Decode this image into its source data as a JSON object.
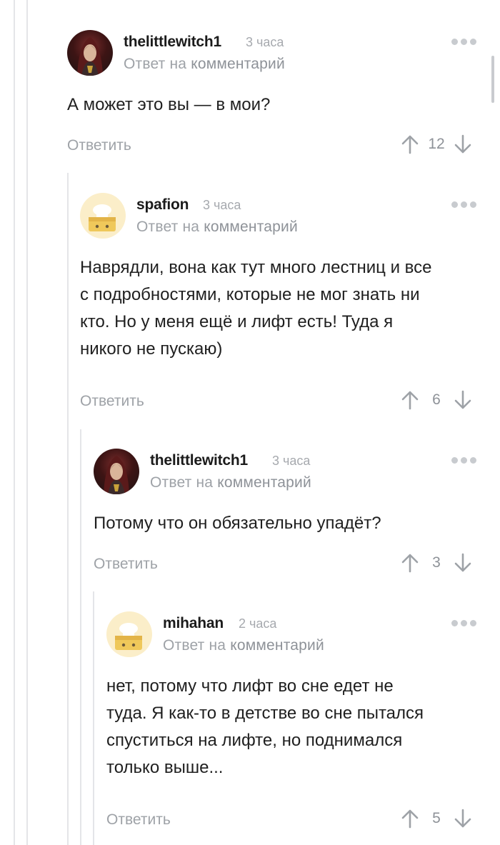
{
  "comments": [
    {
      "username": "thelittlewitch1",
      "time": "3 часа",
      "reply_prefix": "Ответ на",
      "reply_link": "комментарий",
      "text": "А может это вы — в мои?",
      "reply_label": "Ответить",
      "rating": "12",
      "avatar": "witch-avatar"
    },
    {
      "username": "spafion",
      "time": "3 часа",
      "reply_prefix": "Ответ на",
      "reply_link": "комментарий",
      "text_lines": [
        "Наврядли, вона как тут много лестниц и все",
        "с подробностями, которые не мог знать ни",
        "кто. Но у меня ещё и лифт есть! Туда я",
        "никого не пускаю)"
      ],
      "reply_label": "Ответить",
      "rating": "6",
      "avatar": "chef-avatar"
    },
    {
      "username": "thelittlewitch1",
      "time": "3 часа",
      "reply_prefix": "Ответ на",
      "reply_link": "комментарий",
      "text": "Потому что он обязательно упадёт?",
      "reply_label": "Ответить",
      "rating": "3",
      "avatar": "witch-avatar"
    },
    {
      "username": "mihahan",
      "time": "2 часа",
      "reply_prefix": "Ответ на",
      "reply_link": "комментарий",
      "text_lines": [
        "нет, потому что лифт во сне едет не",
        "туда. Я как-то в детстве во сне пытался",
        "спуститься на лифте, но поднимался",
        "только выше..."
      ],
      "reply_label": "Ответить",
      "rating": "5",
      "avatar": "chef-avatar"
    }
  ],
  "icons": {
    "upvote": "arrow-up-icon",
    "downvote": "arrow-down-icon",
    "more": "more-dots-icon"
  },
  "colors": {
    "muted": "#9ea2a7",
    "guide": "#e4e5e8",
    "text": "#1f1f1f"
  }
}
